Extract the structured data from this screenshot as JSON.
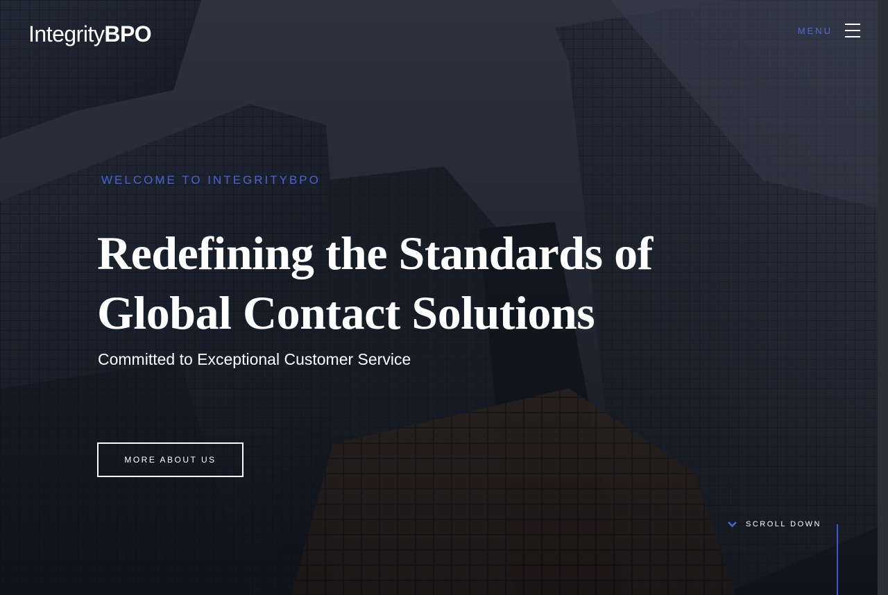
{
  "header": {
    "logo_light": "Integrity",
    "logo_bold": "BPO",
    "menu_label": "MENU"
  },
  "hero": {
    "eyebrow": "WELCOME TO INTEGRITYBPO",
    "headline": "Redefining the Standards of Global Contact Solutions",
    "subhead": "Committed to Exceptional Customer Service",
    "cta_label": "MORE ABOUT US"
  },
  "scroll": {
    "label": "SCROLL DOWN"
  },
  "colors": {
    "accent": "#4a63d6",
    "text": "#ffffff",
    "background": "#141a24"
  },
  "icons": {
    "menu": "hamburger-icon",
    "scroll": "chevron-down-icon"
  }
}
